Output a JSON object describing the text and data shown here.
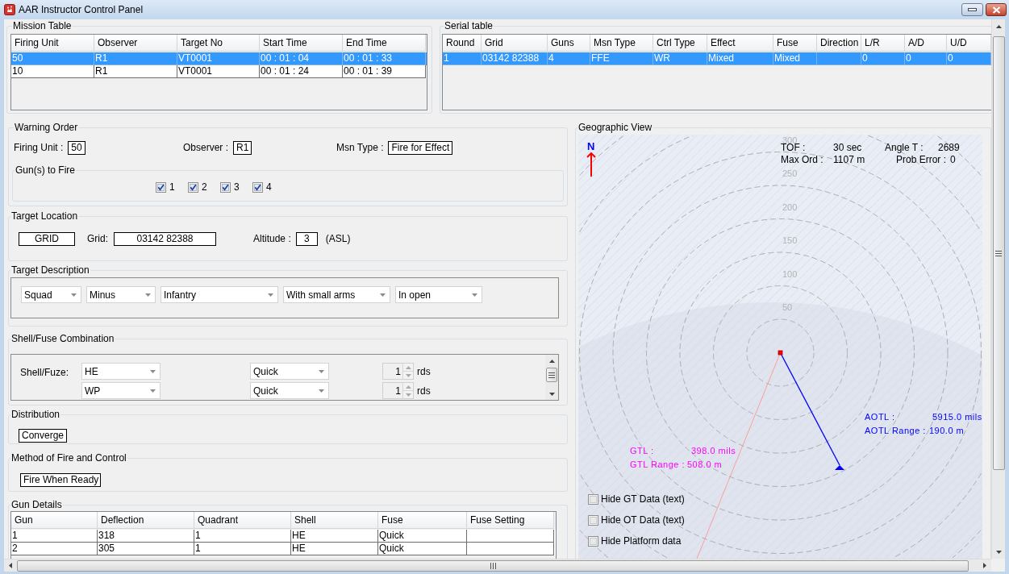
{
  "window": {
    "title": "AAR Instructor Control Panel"
  },
  "mission_table": {
    "title": "Mission Table",
    "columns": [
      "Firing Unit",
      "Observer",
      "Target No",
      "Start Time",
      "End Time"
    ],
    "rows": [
      {
        "cells": [
          "50",
          "R1",
          "VT0001",
          "00 : 01 : 04",
          "00 : 01 : 33"
        ],
        "selected": true
      },
      {
        "cells": [
          "10",
          "R1",
          "VT0001",
          "00 : 01 : 24",
          "00 : 01 : 39"
        ],
        "selected": false
      }
    ]
  },
  "serial_table": {
    "title": "Serial table",
    "columns": [
      "Round",
      "Grid",
      "Guns",
      "Msn Type",
      "Ctrl Type",
      "Effect",
      "Fuse",
      "Direction",
      "L/R",
      "A/D",
      "U/D"
    ],
    "rows": [
      {
        "cells": [
          "1",
          "03142 82388",
          "4",
          "FFE",
          "WR",
          "Mixed",
          "Mixed",
          null,
          "0",
          "0",
          "0"
        ],
        "selected": true
      }
    ]
  },
  "warning_order": {
    "title": "Warning Order",
    "fields": [
      {
        "label": "Firing Unit :",
        "value": "50"
      },
      {
        "label": "Observer :",
        "value": "R1"
      },
      {
        "label": "Msn Type :",
        "value": "Fire for Effect"
      }
    ],
    "guns_to_fire": {
      "title": "Gun(s) to Fire",
      "guns": [
        {
          "label": "1",
          "checked": true
        },
        {
          "label": "2",
          "checked": true
        },
        {
          "label": "3",
          "checked": true
        },
        {
          "label": "4",
          "checked": true
        }
      ]
    }
  },
  "target_location": {
    "title": "Target Location",
    "method": "GRID",
    "grid_label": "Grid:",
    "grid": "03142 82388",
    "altitude_label": "Altitude :",
    "altitude": "3",
    "altitude_unit": "(ASL)"
  },
  "target_description": {
    "title": "Target Description",
    "selections": [
      "Squad",
      "Minus",
      "Infantry",
      "With small arms",
      "In open"
    ]
  },
  "shell_fuse": {
    "title": "Shell/Fuse Combination",
    "label": "Shell/Fuze:",
    "rows": [
      {
        "shell": "HE",
        "fuse": "Quick",
        "rounds": "1",
        "unit": "rds"
      },
      {
        "shell": "WP",
        "fuse": "Quick",
        "rounds": "1",
        "unit": "rds"
      }
    ]
  },
  "distribution": {
    "title": "Distribution",
    "value": "Converge"
  },
  "method_of_fire": {
    "title": "Method of Fire and Control",
    "value": "Fire When Ready"
  },
  "gun_details": {
    "title": "Gun Details",
    "columns": [
      "Gun",
      "Deflection",
      "Quadrant",
      "Shell",
      "Fuse",
      "Fuse Setting"
    ],
    "rows": [
      [
        "1",
        "318",
        "1",
        "HE",
        "Quick"
      ],
      [
        "2",
        "305",
        "1",
        "HE",
        "Quick"
      ]
    ]
  },
  "geographic_view": {
    "title": "Geographic View",
    "north": "N",
    "ring_labels": [
      "300",
      "250",
      "200",
      "150",
      "100",
      "50"
    ],
    "stats": [
      {
        "label": "TOF :",
        "value": "30 sec"
      },
      {
        "label": "Angle T :",
        "value": "2689"
      },
      {
        "label": "Max Ord :",
        "value": "1107 m"
      },
      {
        "label": "Prob Error :",
        "value": "0"
      }
    ],
    "gun_target": [
      {
        "label": "GTL :",
        "value": "398.0 mils"
      },
      {
        "label": "GTL Range :",
        "value": "508.0 m"
      }
    ],
    "observer_target": [
      {
        "label": "AOTL :",
        "value": "5915.0 mils"
      },
      {
        "label": "AOTL Range :",
        "value": "190.0 m"
      }
    ],
    "options": [
      {
        "label": "Hide GT Data (text)",
        "checked": false
      },
      {
        "label": "Hide OT Data (text)",
        "checked": false
      },
      {
        "label": "Hide Platform data",
        "checked": false
      }
    ]
  }
}
